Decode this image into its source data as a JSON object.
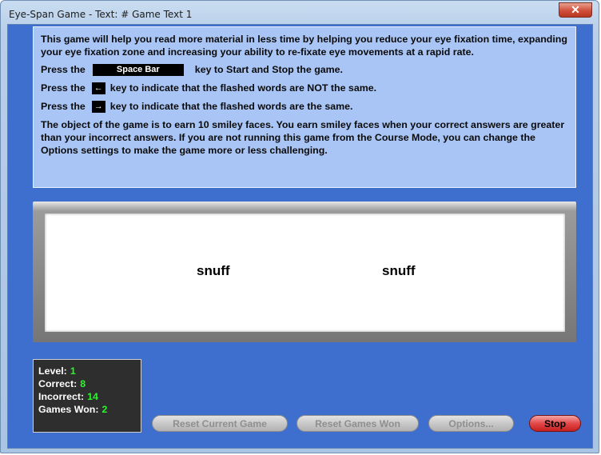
{
  "window": {
    "title": "Eye-Span Game - Text: # Game Text 1",
    "close_label": "✕"
  },
  "instructions": {
    "intro": "This game will help you read more material in less time by helping you reduce your eye fixation time, expanding your eye fixation zone and increasing your ability to re-fixate eye movements at a rapid rate.",
    "press_label": "Press the",
    "space_key_label": "Space Bar",
    "space_text": "key to Start and Stop the game.",
    "left_arrow": "←",
    "left_text": "key to indicate that the flashed words are NOT the same.",
    "right_arrow": "→",
    "right_text": "key to indicate that the flashed words are the same.",
    "objective": "The object of the game is to earn 10 smiley faces.  You earn smiley faces when your correct answers are greater than your incorrect answers.  If you are not running this game from the Course Mode, you can change the Options settings to make the game more or less challenging."
  },
  "stage": {
    "left_word": "snuff",
    "right_word": "snuff"
  },
  "stats": {
    "level_label": "Level:",
    "level_value": "1",
    "correct_label": "Correct:",
    "correct_value": "8",
    "incorrect_label": "Incorrect:",
    "incorrect_value": "14",
    "games_won_label": "Games Won:",
    "games_won_value": "2"
  },
  "buttons": {
    "reset_current_game": "Reset Current Game",
    "reset_games_won": "Reset Games Won",
    "options": "Options...",
    "stop": "Stop"
  },
  "colors": {
    "client_bg": "#3e6fce",
    "instructions_bg": "#a9c5f5",
    "stat_value": "#2cf52c",
    "stop_button": "#e34848"
  }
}
